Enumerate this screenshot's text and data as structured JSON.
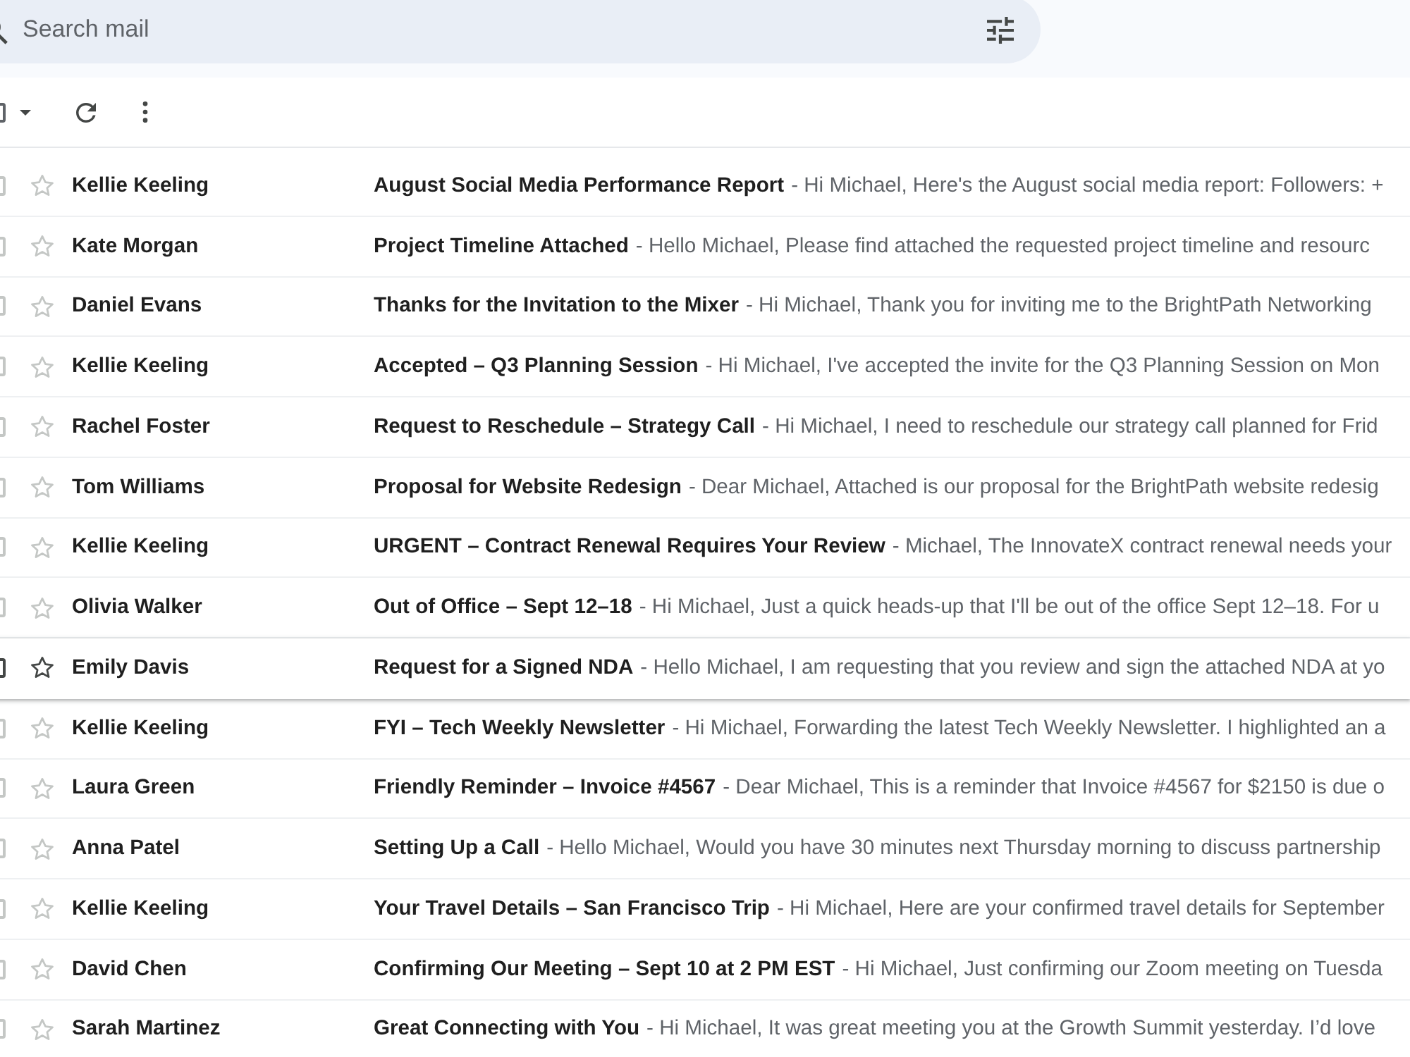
{
  "search": {
    "placeholder": "Search mail"
  },
  "toolbar": {
    "select_all": {
      "checked": false
    }
  },
  "rows": [
    {
      "sender": "Kellie Keeling",
      "subject": "August Social Media Performance Report",
      "snippet": "- Hi Michael, Here's the August social media report: Followers: +",
      "unread": true,
      "starred": false,
      "checked": false,
      "hovered": false
    },
    {
      "sender": "Kate Morgan",
      "subject": "Project Timeline Attached",
      "snippet": "- Hello Michael, Please find attached the requested project timeline and resourc",
      "unread": true,
      "starred": false,
      "checked": false,
      "hovered": false
    },
    {
      "sender": "Daniel Evans",
      "subject": "Thanks for the Invitation to the Mixer",
      "snippet": "- Hi Michael, Thank you for inviting me to the BrightPath Networking",
      "unread": true,
      "starred": false,
      "checked": false,
      "hovered": false
    },
    {
      "sender": "Kellie Keeling",
      "subject": "Accepted – Q3 Planning Session",
      "snippet": "- Hi Michael, I've accepted the invite for the Q3 Planning Session on Mon",
      "unread": true,
      "starred": false,
      "checked": false,
      "hovered": false
    },
    {
      "sender": "Rachel Foster",
      "subject": "Request to Reschedule – Strategy Call",
      "snippet": "- Hi Michael, I need to reschedule our strategy call planned for Frid",
      "unread": true,
      "starred": false,
      "checked": false,
      "hovered": false
    },
    {
      "sender": "Tom Williams",
      "subject": "Proposal for Website Redesign",
      "snippet": "- Dear Michael, Attached is our proposal for the BrightPath website redesig",
      "unread": true,
      "starred": false,
      "checked": false,
      "hovered": false
    },
    {
      "sender": "Kellie Keeling",
      "subject": "URGENT – Contract Renewal Requires Your Review",
      "snippet": "- Michael, The InnovateX contract renewal needs your",
      "unread": true,
      "starred": false,
      "checked": false,
      "hovered": false
    },
    {
      "sender": "Olivia Walker",
      "subject": "Out of Office – Sept 12–18",
      "snippet": "- Hi Michael, Just a quick heads-up that I'll be out of the office Sept 12–18. For u",
      "unread": true,
      "starred": false,
      "checked": false,
      "hovered": false
    },
    {
      "sender": "Emily Davis",
      "subject": "Request for a Signed NDA",
      "snippet": "- Hello Michael, I am requesting that you review and sign the attached NDA at yo",
      "unread": true,
      "starred": false,
      "checked": false,
      "hovered": true
    },
    {
      "sender": "Kellie Keeling",
      "subject": "FYI – Tech Weekly Newsletter",
      "snippet": "- Hi Michael, Forwarding the latest Tech Weekly Newsletter. I highlighted an a",
      "unread": true,
      "starred": false,
      "checked": false,
      "hovered": false
    },
    {
      "sender": "Laura Green",
      "subject": "Friendly Reminder – Invoice #4567",
      "snippet": "- Dear Michael, This is a reminder that Invoice #4567 for $2150 is due o",
      "unread": true,
      "starred": false,
      "checked": false,
      "hovered": false
    },
    {
      "sender": "Anna Patel",
      "subject": "Setting Up a Call",
      "snippet": "- Hello Michael, Would you have 30 minutes next Thursday morning to discuss partnership",
      "unread": true,
      "starred": false,
      "checked": false,
      "hovered": false
    },
    {
      "sender": "Kellie Keeling",
      "subject": "Your Travel Details – San Francisco Trip",
      "snippet": "- Hi Michael, Here are your confirmed travel details for September",
      "unread": true,
      "starred": false,
      "checked": false,
      "hovered": false
    },
    {
      "sender": "David Chen",
      "subject": "Confirming Our Meeting – Sept 10 at 2 PM EST",
      "snippet": "- Hi Michael, Just confirming our Zoom meeting on Tuesda",
      "unread": true,
      "starred": false,
      "checked": false,
      "hovered": false
    },
    {
      "sender": "Sarah Martinez",
      "subject": "Great Connecting with You",
      "snippet": "- Hi Michael, It was great meeting you at the Growth Summit yesterday. I’d love",
      "unread": true,
      "starred": false,
      "checked": false,
      "hovered": false
    }
  ]
}
